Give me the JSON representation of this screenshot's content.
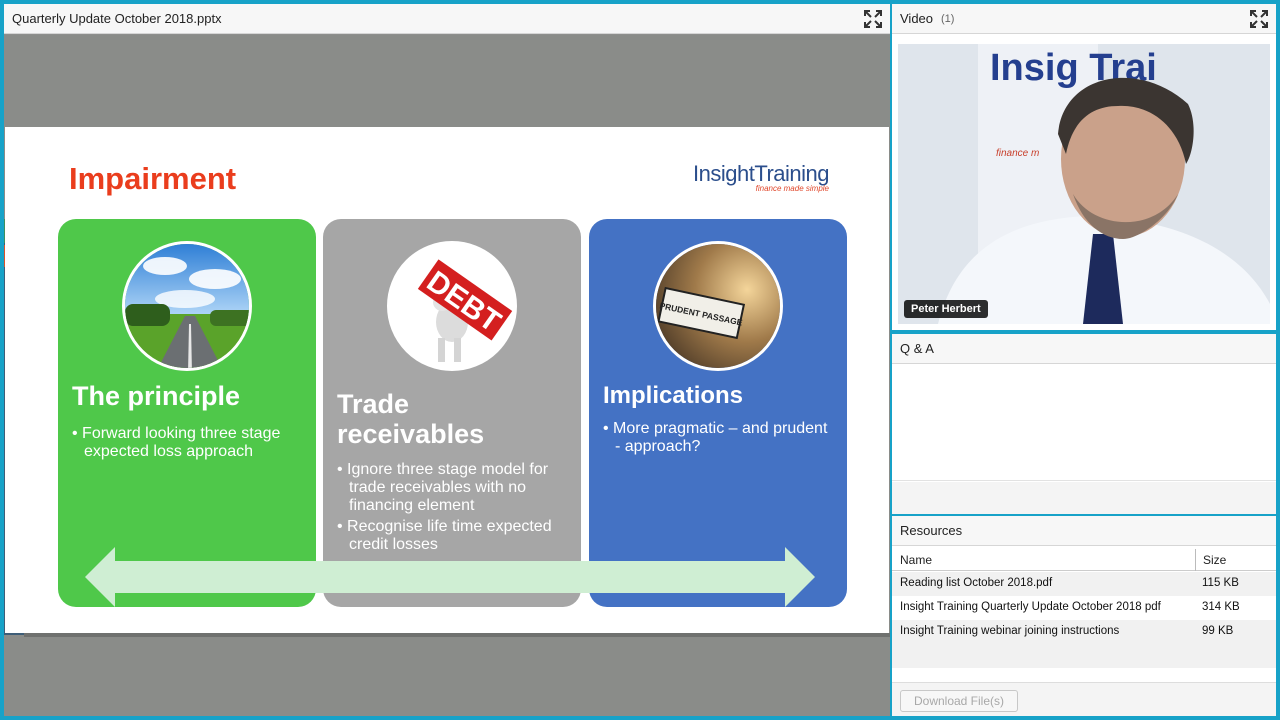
{
  "share": {
    "title": "Quarterly Update October 2018.pptx",
    "slide": {
      "title": "Impairment",
      "logo_main": "InsightTraining",
      "logo_tag": "finance made simple",
      "cards": [
        {
          "heading": "The principle",
          "bullets": [
            "Forward looking three stage expected loss approach"
          ],
          "image": "road-landscape"
        },
        {
          "heading": "Trade receivables",
          "bullets": [
            "Ignore three stage model for trade receivables with no financing element",
            "Recognise life time expected credit losses"
          ],
          "image": "debt-figure",
          "image_text": "DEBT"
        },
        {
          "heading": "Implications",
          "bullets": [
            "More pragmatic – and prudent - approach?"
          ],
          "image": "prudent-passage-sign",
          "image_text": "PRUDENT PASSAGE"
        }
      ],
      "colors": {
        "title": "#ea3d1d",
        "green": "#4fc84a",
        "grey": "#a6a6a6",
        "blue": "#4472c4",
        "arrow": "#cfeed3"
      }
    }
  },
  "video": {
    "title": "Video",
    "count": "(1)",
    "presenter_name": "Peter Herbert",
    "backdrop_text": "Insig Trai",
    "backdrop_tag": "finance m"
  },
  "qa": {
    "title": "Q & A"
  },
  "resources": {
    "title": "Resources",
    "columns": {
      "name": "Name",
      "size": "Size"
    },
    "files": [
      {
        "name": "Reading list October 2018.pdf",
        "size": "115 KB"
      },
      {
        "name": "Insight Training Quarterly Update October 2018 pdf",
        "size": "314 KB"
      },
      {
        "name": "Insight Training webinar joining instructions",
        "size": "99 KB"
      }
    ],
    "download_label": "Download File(s)"
  },
  "icons": {
    "fullscreen": "fullscreen-icon"
  }
}
